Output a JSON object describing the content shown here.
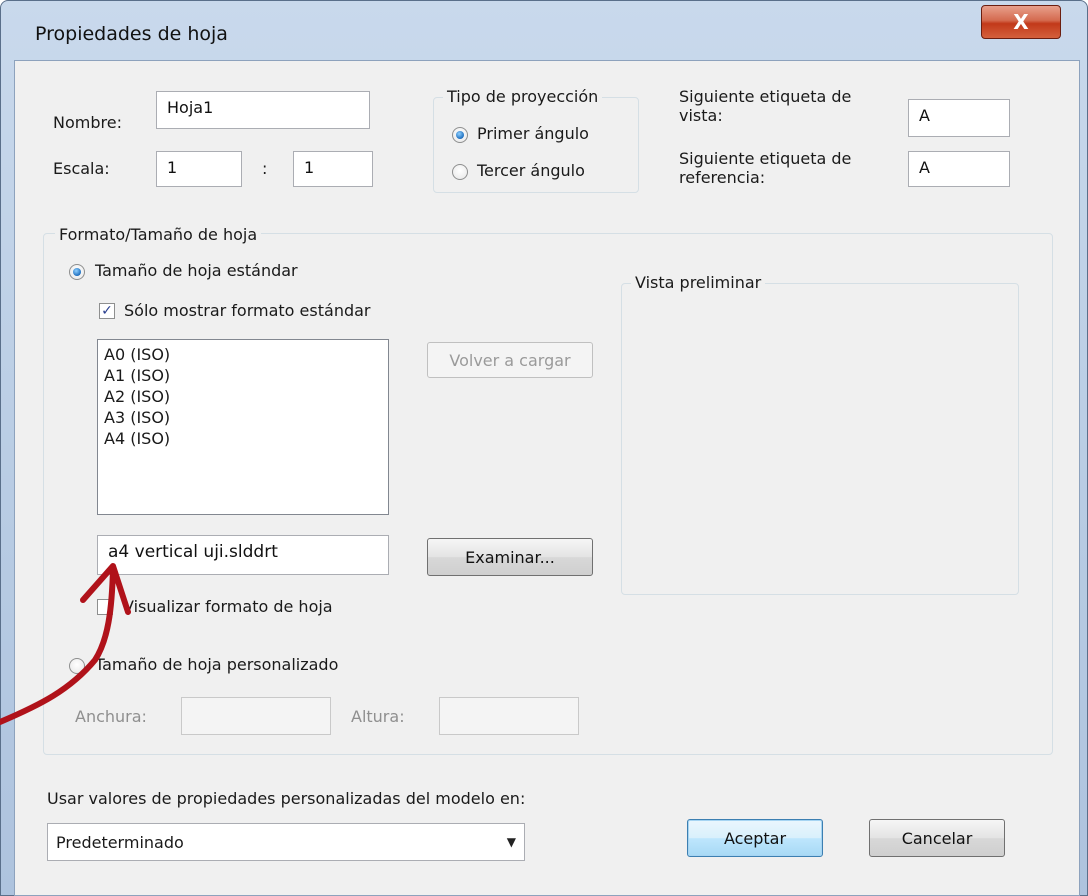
{
  "window": {
    "title": "Propiedades de hoja",
    "close_glyph": "X"
  },
  "sheet": {
    "name_label": "Nombre:",
    "name_value": "Hoja1",
    "scale_label": "Escala:",
    "scale_num": "1",
    "scale_sep": ":",
    "scale_den": "1"
  },
  "projection": {
    "title": "Tipo de proyección",
    "first_angle": "Primer ángulo",
    "third_angle": "Tercer ángulo",
    "selected": "first_angle"
  },
  "labels": {
    "next_view_label": "Siguiente etiqueta de vista:",
    "next_view_value": "A",
    "next_ref_label": "Siguiente etiqueta de referencia:",
    "next_ref_value": "A"
  },
  "format": {
    "group_title": "Formato/Tamaño de hoja",
    "standard_size": "Tamaño de hoja estándar",
    "only_standard": "Sólo mostrar formato estándar",
    "sizes": [
      "A0 (ISO)",
      "A1 (ISO)",
      "A2 (ISO)",
      "A3 (ISO)",
      "A4 (ISO)"
    ],
    "reload_button": "Volver a cargar",
    "format_file": "a4 vertical uji.slddrt",
    "browse_button": "Examinar...",
    "display_format": "Visualizar formato de hoja",
    "custom_size": "Tamaño de hoja personalizado",
    "width_label": "Anchura:",
    "height_label": "Altura:",
    "preview_title": "Vista preliminar"
  },
  "custom_props": {
    "label": "Usar valores de propiedades personalizadas del modelo en:",
    "selected": "Predeterminado"
  },
  "buttons": {
    "ok": "Aceptar",
    "cancel": "Cancelar"
  },
  "colors": {
    "annotation_arrow": "#b0121a",
    "title_gradient": "#c9d9ec",
    "close_red": "#c2391a"
  }
}
